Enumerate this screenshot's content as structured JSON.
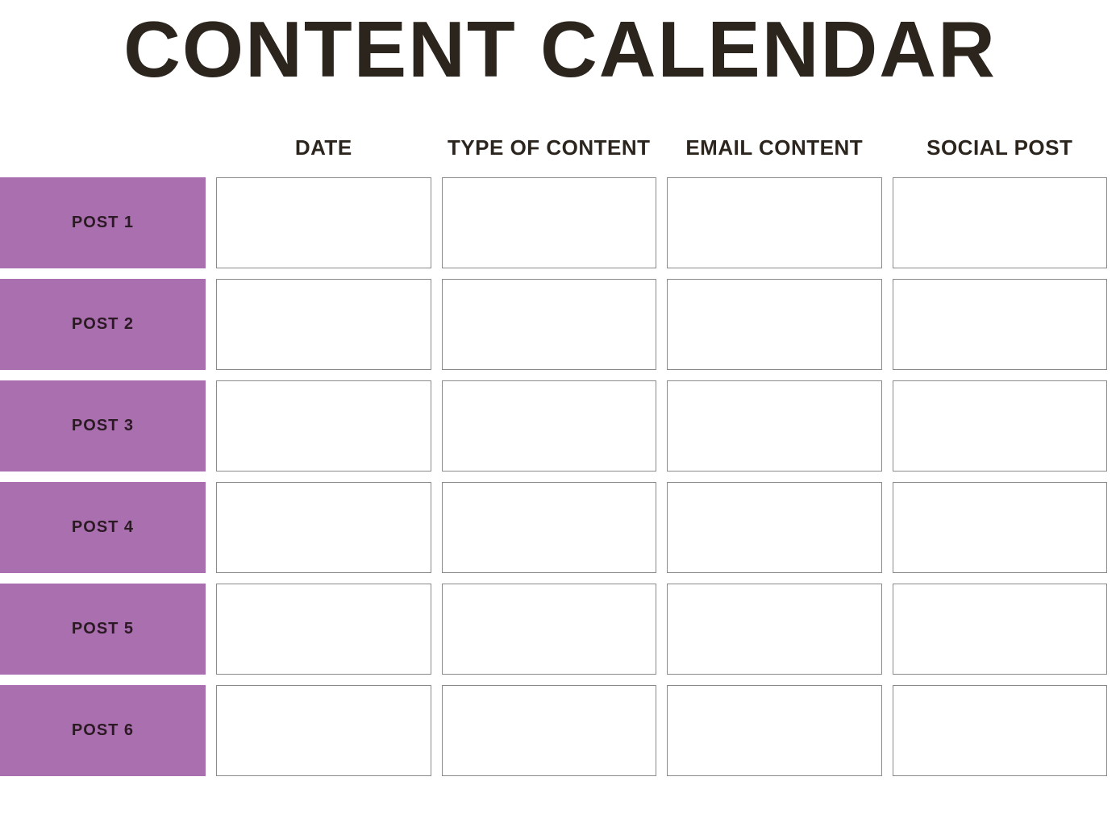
{
  "title": "CONTENT CALENDAR",
  "columns": [
    "DATE",
    "TYPE OF CONTENT",
    "EMAIL CONTENT",
    "SOCIAL POST"
  ],
  "rows": [
    {
      "label": "POST 1",
      "cells": [
        "",
        "",
        "",
        ""
      ]
    },
    {
      "label": "POST 2",
      "cells": [
        "",
        "",
        "",
        ""
      ]
    },
    {
      "label": "POST 3",
      "cells": [
        "",
        "",
        "",
        ""
      ]
    },
    {
      "label": "POST 4",
      "cells": [
        "",
        "",
        "",
        ""
      ]
    },
    {
      "label": "POST 5",
      "cells": [
        "",
        "",
        "",
        ""
      ]
    },
    {
      "label": "POST 6",
      "cells": [
        "",
        "",
        "",
        ""
      ]
    }
  ],
  "colors": {
    "title": "#2b251e",
    "row_label_bg": "#a96fae",
    "cell_border": "#8a8a8a"
  }
}
